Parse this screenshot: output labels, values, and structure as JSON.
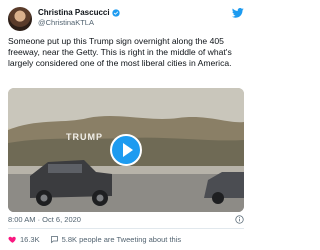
{
  "author": {
    "display_name": "Christina Pascucci",
    "handle": "@ChristinaKTLA",
    "verified": true
  },
  "tweet": {
    "text": "Someone put up this Trump sign overnight along the 405 freeway, near the Getty. This is right in the middle of what's largely considered one of the most liberal cities in America.",
    "media_sign_text": "TRUMP",
    "timestamp": "8:00 AM · Oct 6, 2020"
  },
  "actions": {
    "likes": "16.3K",
    "talking": "5.8K people are Tweeting about this"
  },
  "colors": {
    "accent": "#1d9bf0",
    "like": "#f91880",
    "secondary_text": "#536471"
  },
  "icons": [
    "verified-icon",
    "twitter-logo-icon",
    "play-icon",
    "info-icon",
    "heart-icon",
    "chat-bubble-icon"
  ]
}
